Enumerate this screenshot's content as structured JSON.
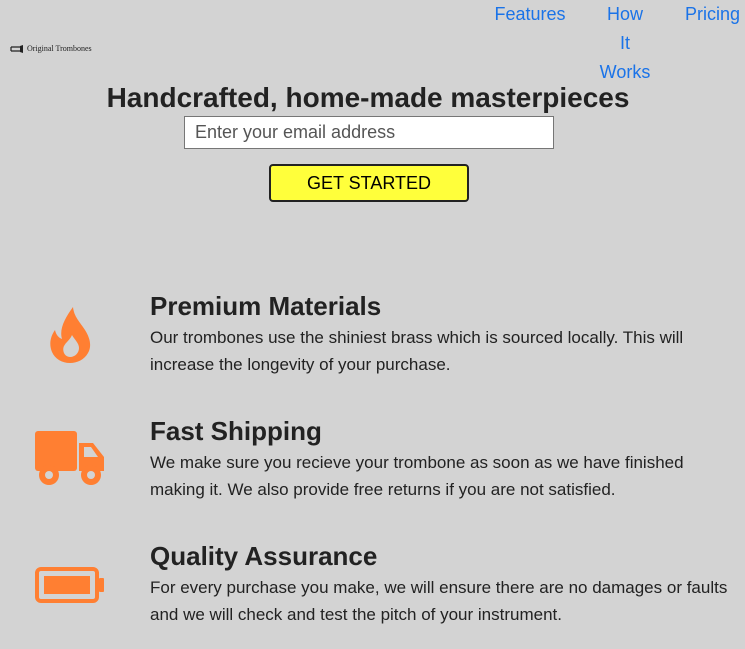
{
  "brand": {
    "name": "Original Trombones",
    "icon": "trombone-logo-icon"
  },
  "nav": {
    "features": "Features",
    "how_it_works_lines": [
      "How",
      "It",
      "Works"
    ],
    "pricing": "Pricing"
  },
  "hero": {
    "title": "Handcrafted, home-made masterpieces",
    "email_placeholder": "Enter your email address",
    "cta_label": "GET STARTED"
  },
  "features": [
    {
      "icon": "fire-icon",
      "title": "Premium Materials",
      "text": "Our trombones use the shiniest brass which is sourced locally. This will increase the longevity of your purchase."
    },
    {
      "icon": "truck-icon",
      "title": "Fast Shipping",
      "text": "We make sure you recieve your trombone as soon as we have finished making it. We also provide free returns if you are not satisfied."
    },
    {
      "icon": "battery-icon",
      "title": "Quality Assurance",
      "text": "For every purchase you make, we will ensure there are no damages or faults and we will check and test the pitch of your instrument."
    }
  ],
  "colors": {
    "background": "#d3d3d3",
    "link": "#1a73e8",
    "accent_icon": "#ff7f32",
    "cta_background": "#ffff3b",
    "text": "#222222"
  }
}
